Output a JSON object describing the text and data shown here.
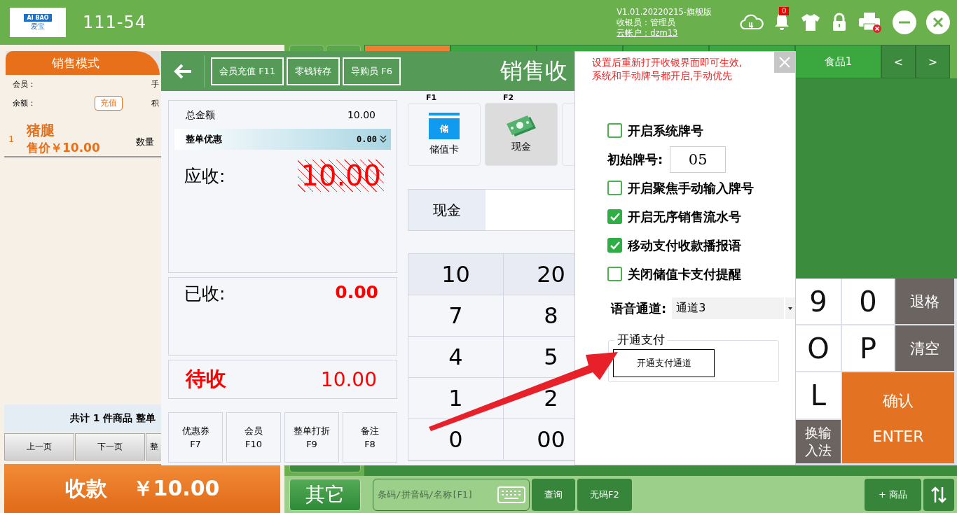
{
  "logo": {
    "text": "AI BAO",
    "subtext": "爱宝"
  },
  "header": {
    "store_code": "111-54",
    "version": "V1.01.20220215-旗舰版",
    "cashier": "收银员：管理员",
    "account": "云帐户：dzm13",
    "notification_count": "0"
  },
  "sale_panel": {
    "mode_tab": "销售模式",
    "member_label": "会员：",
    "phone_label": "手",
    "balance_label": "余额：",
    "recharge_button": "充值",
    "points_label": "积",
    "items": [
      {
        "index": "1",
        "name": "猪腿",
        "price": "售价￥10.00",
        "qty_label": "数量"
      }
    ],
    "summary": "共计 1 件商品 整单",
    "pager": [
      "上一页",
      "下一页",
      "整"
    ],
    "checkout": {
      "label": "收款",
      "amount": "￥10.00"
    }
  },
  "category_tabs": [
    {
      "selected": true
    },
    {
      "selected": false
    },
    {
      "selected": false
    },
    {
      "selected": false
    },
    {
      "selected": false
    },
    {
      "label": "食品1",
      "selected": false
    }
  ],
  "tab_nav": [
    "<",
    ">"
  ],
  "bottom_bar": {
    "other_button": "其它",
    "search_placeholder": "条码/拼音码/名称[F1]",
    "query_button": "查询",
    "no_code_button": "无码F2",
    "add_button": "+ 商品"
  },
  "keyboard": [
    {
      "label": "9",
      "kind": "char"
    },
    {
      "label": "0",
      "kind": "char"
    },
    {
      "label": "退格",
      "kind": "func"
    },
    {
      "label": "O",
      "kind": "char"
    },
    {
      "label": "P",
      "kind": "char"
    },
    {
      "label": "清空",
      "kind": "func"
    },
    {
      "label": "L",
      "kind": "char"
    },
    {
      "label": "确认",
      "sublabel": "ENTER",
      "kind": "enter"
    },
    {
      "label": "换输入法",
      "kind": "func"
    }
  ],
  "payment_dialog": {
    "toolbar": [
      "会员充值 F11",
      "零钱转存",
      "导购员 F6"
    ],
    "title": "销售收",
    "total_label": "总金额",
    "total": "10.00",
    "discount_label": "整单优惠",
    "discount": "0.00",
    "due_label": "应收:",
    "due": "10.00",
    "received_label": "已收:",
    "received": "0.00",
    "pending_label": "待收",
    "pending": "10.00",
    "actions": [
      {
        "label": "优惠券",
        "key": "F7"
      },
      {
        "label": "会员",
        "key": "F10"
      },
      {
        "label": "整单打折",
        "key": "F9"
      },
      {
        "label": "备注",
        "key": "F8"
      }
    ],
    "methods": [
      {
        "key": "F1",
        "label": "储值卡",
        "kind": "card",
        "badge": "储",
        "selected": false
      },
      {
        "key": "F2",
        "label": "现金",
        "kind": "cash",
        "selected": true
      },
      {
        "selected": false
      }
    ],
    "cash_label": "现金",
    "numpad": [
      {
        "label": "10",
        "kind": "preset"
      },
      {
        "label": "20",
        "kind": "preset"
      },
      {
        "label": "7",
        "kind": "digit"
      },
      {
        "label": "8",
        "kind": "digit"
      },
      {
        "label": "4",
        "kind": "digit"
      },
      {
        "label": "5",
        "kind": "digit"
      },
      {
        "label": "1",
        "kind": "digit"
      },
      {
        "label": "2",
        "kind": "digit"
      },
      {
        "label": "0",
        "kind": "digit"
      },
      {
        "label": "00",
        "kind": "digit"
      }
    ]
  },
  "settings_dialog": {
    "note": [
      "设置后重新打开收银界面即可生效,",
      "系统和手动牌号都开启,手动优先"
    ],
    "options": [
      {
        "kind": "checkbox",
        "label": "开启系统牌号",
        "checked": false
      },
      {
        "kind": "number",
        "label": "初始牌号:",
        "value": "05"
      },
      {
        "kind": "checkbox",
        "label": "开启聚焦手动输入牌号",
        "checked": false
      },
      {
        "kind": "checkbox",
        "label": "开启无序销售流水号",
        "checked": true
      },
      {
        "kind": "checkbox",
        "label": "移动支付收款播报语",
        "checked": true
      },
      {
        "kind": "checkbox",
        "label": "关闭储值卡支付提醒",
        "checked": false
      },
      {
        "kind": "select",
        "label": "语音通道:",
        "value": "通道3"
      }
    ],
    "payment_group": {
      "legend": "开通支付",
      "button": "开通支付通道"
    }
  }
}
